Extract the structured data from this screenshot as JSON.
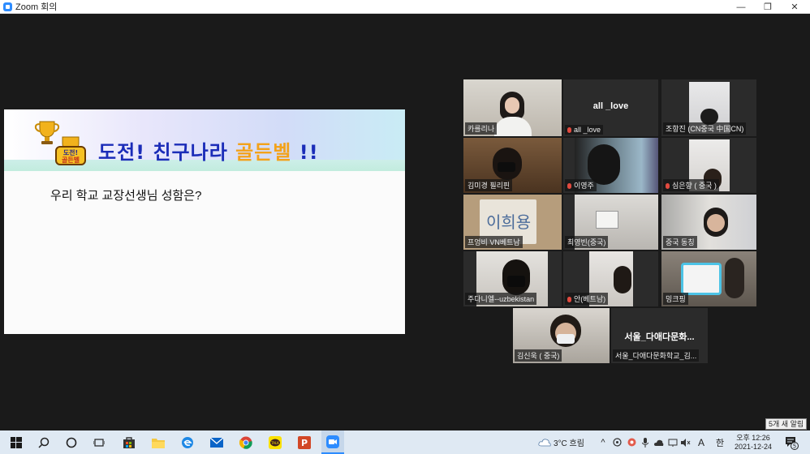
{
  "window": {
    "title": "Zoom 회의",
    "minimize_glyph": "—",
    "restore_glyph": "❐",
    "close_glyph": "✕"
  },
  "share": {
    "banner_title_main": "도전! 친구나라 ",
    "banner_title_gold": "골든벨",
    "banner_title_end": " !!",
    "badge_text": "도전! 골든벨",
    "question": "우리 학교 교장선생님 성함은?"
  },
  "participants": [
    {
      "name": "카를리나",
      "muted": false
    },
    {
      "name": "all _love",
      "display": "all _love",
      "muted": true
    },
    {
      "name": "조항진 (CN중국 中国CN)",
      "muted": false
    },
    {
      "name": "김미경 필리핀",
      "muted": false
    },
    {
      "name": "이영주",
      "muted": true
    },
    {
      "name": "심은향 ( 중국 )",
      "muted": true
    },
    {
      "name": "프엉비 VN베트남",
      "muted": false
    },
    {
      "name": "최영빈(중국)",
      "muted": false
    },
    {
      "name": "중국 동칭",
      "muted": false
    },
    {
      "name": "주다니엘--uzbekistan",
      "muted": false
    },
    {
      "name": "안(베트남)",
      "muted": true
    },
    {
      "name": "밍크핑",
      "muted": false
    },
    {
      "name": "김신욱 ( 중국)",
      "muted": false
    },
    {
      "name": "서울_다애다문화학교_김...",
      "display": "서울_다애다문화...",
      "muted": false
    }
  ],
  "taskbar": {
    "weather": "3°C  흐림",
    "ime": "A",
    "ime2": "한",
    "time": "오후 12:26",
    "date": "2021-12-24",
    "notification_count": "5",
    "notification_text": "5개 새 알림",
    "icons": [
      "windows-start-icon",
      "search-icon",
      "cortana-icon",
      "task-view-icon",
      "store-icon",
      "file-explorer-icon",
      "edge-icon",
      "mail-icon",
      "chrome-icon",
      "kakaotalk-icon",
      "powerpoint-icon",
      "zoom-icon"
    ]
  },
  "colors": {
    "banner_blue": "#1b2cb8",
    "banner_gold": "#f3a21a",
    "active_speaker": "#c5d94a",
    "zoom_blue": "#2d8cff",
    "muted_red": "#e14a3f"
  }
}
